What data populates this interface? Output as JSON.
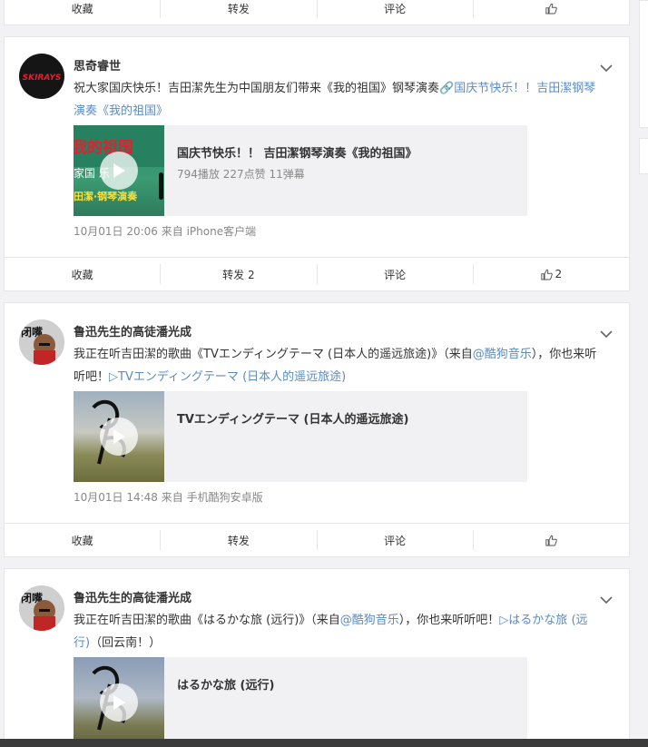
{
  "toolbar_top": {
    "fav": "收藏",
    "forward": "转发",
    "comment": "评论",
    "like_count": ""
  },
  "post1": {
    "username": "思奇睿世",
    "avatar_text": "SKIRAYS",
    "text_prefix": "祝大家国庆快乐！吉田潔先生为中国朋友们带来《我的祖国》钢琴演奏",
    "text_link": "🔗国庆节快乐！！吉田潔钢琴演奏《我的祖国》",
    "media_title": "国庆节快乐！！ 吉田潔钢琴演奏《我的祖国》",
    "media_stats": "794播放 227点赞 11弹幕",
    "cover_top_text": "我的祖国",
    "cover_mid_text": "家国 乐",
    "cover_bottom_text": "田潔·钢琴演奏",
    "meta": "10月01日 20:06  来自 iPhone客户端",
    "actions": {
      "fav": "收藏",
      "forward": "转发 2",
      "comment": "评论",
      "like_count": "2"
    }
  },
  "post2": {
    "username": "鲁迅先生的高徒潘光成",
    "avatar_text": "闭嘴",
    "text_prefix": "我正在听吉田潔的歌曲《TVエンディングテーマ (日本人的遥远旅途)》（来自",
    "text_mention": "@酷狗音乐",
    "text_mid": "），你也来听听吧！",
    "text_link": "▷TVエンディングテーマ (日本人的遥远旅途)",
    "media_title": "TVエンディングテーマ (日本人的遥远旅途)",
    "meta": "10月01日 14:48  来自 手机酷狗安卓版",
    "actions": {
      "fav": "收藏",
      "forward": "转发",
      "comment": "评论",
      "like_count": ""
    }
  },
  "post3": {
    "username": "鲁迅先生的高徒潘光成",
    "avatar_text": "闭嘴",
    "text_prefix": "我正在听吉田潔的歌曲《はるかな旅 (远行)》（来自",
    "text_mention": "@酷狗音乐",
    "text_mid": "），你也来听听吧！",
    "text_link": "▷はるかな旅 (远行)",
    "text_suffix": "（回云南！）",
    "media_title": "はるかな旅 (远行)"
  }
}
